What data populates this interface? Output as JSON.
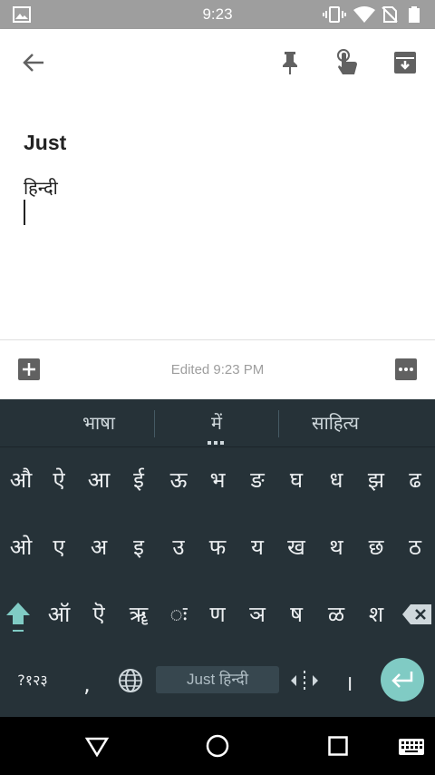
{
  "status": {
    "time": "9:23"
  },
  "note": {
    "title": "Just",
    "body": "हिन्दी",
    "edited_label": "Edited 9:23 PM"
  },
  "keyboard": {
    "suggestions": [
      "भाषा",
      "में",
      "साहित्य"
    ],
    "row1": [
      "औ",
      "ऐ",
      "आ",
      "ई",
      "ऊ",
      "भ",
      "ङ",
      "घ",
      "ध",
      "झ",
      "ढ"
    ],
    "row2": [
      "ओ",
      "ए",
      "अ",
      "इ",
      "उ",
      "फ",
      "य",
      "ख",
      "थ",
      "छ",
      "ठ"
    ],
    "row3": [
      "ऑ",
      "ऎ",
      "ॠ",
      "ः",
      "ण",
      "ञ",
      "ष",
      "ळ",
      "श"
    ],
    "symbols_label": "?१२३",
    "comma_label": ",",
    "space_label": "Just हिन्दी",
    "danda_label": "।"
  },
  "colors": {
    "status_bar": "#9e9e9e",
    "keyboard_bg": "#263238",
    "accent": "#80cbc4"
  }
}
